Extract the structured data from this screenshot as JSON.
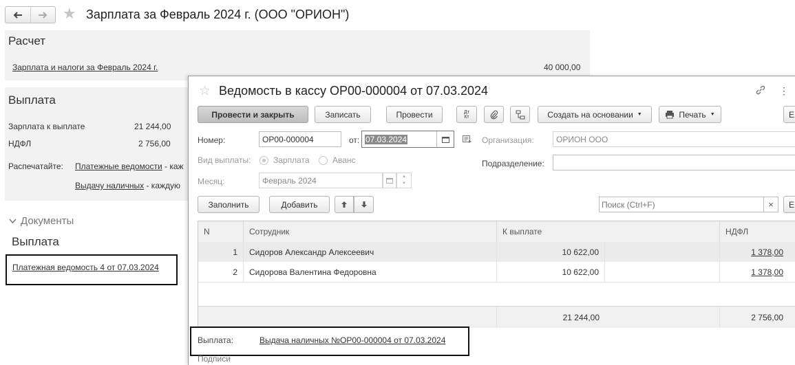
{
  "page": {
    "title": "Зарплата за Февраль 2024 г. (ООО \"ОРИОН\")"
  },
  "raschet": {
    "heading": "Расчет",
    "link_label": "Зарплата и налоги за Февраль 2024 г.",
    "amount": "40 000,00"
  },
  "vyplata": {
    "heading": "Выплата",
    "rows": [
      {
        "label": "Зарплата к выплате",
        "value": "21 244,00"
      },
      {
        "label": "НДФЛ",
        "value": "2 756,00"
      }
    ],
    "print_label": "Распечатайте:",
    "print_links": [
      {
        "label": "Платежные ведомости",
        "suffix": " - каж"
      },
      {
        "label": "Выдачу наличных",
        "suffix": " - каждую"
      }
    ]
  },
  "documents": {
    "toggle_label": "Документы",
    "heading": "Выплата",
    "doc_link": "Платежная ведомость 4 от 07.03.2024"
  },
  "dialog": {
    "title": "Ведомость в кассу ОР00-000004 от 07.03.2024",
    "toolbar": {
      "post_close": "Провести и закрыть",
      "save": "Записать",
      "post": "Провести",
      "dtkt": "Дт Кт",
      "create_based": "Создать на основании",
      "print": "Печать",
      "more": "Е"
    },
    "fields": {
      "number_label": "Номер:",
      "number_value": "ОР00-000004",
      "date_label": "от:",
      "date_value": "07.03.2024",
      "org_label": "Организация:",
      "org_value": "ОРИОН ООО",
      "paytype_label": "Вид выплаты:",
      "paytype_option1": "Зарплата",
      "paytype_option2": "Аванс",
      "division_label": "Подразделение:",
      "division_value": "",
      "month_label": "Месяц:",
      "month_value": "Февраль 2024"
    },
    "table_toolbar": {
      "fill": "Заполнить",
      "add": "Добавить",
      "search_placeholder": "Поиск (Ctrl+F)",
      "clear": "×",
      "more": "Е"
    },
    "table": {
      "headers": {
        "n": "N",
        "employee": "Сотрудник",
        "to_pay": "К выплате",
        "ndfl": "НДФЛ"
      },
      "rows": [
        {
          "n": "1",
          "employee": "Сидоров Александр Алексеевич",
          "to_pay": "10 622,00",
          "ndfl": "1 378,00"
        },
        {
          "n": "2",
          "employee": "Сидорова Валентина Федоровна",
          "to_pay": "10 622,00",
          "ndfl": "1 378,00"
        }
      ],
      "totals": {
        "to_pay": "21 244,00",
        "ndfl": "2 756,00"
      }
    },
    "footer": {
      "payment_label": "Выплата:",
      "payment_link": "Выдача наличных №ОР00-000004 от 07.03.2024",
      "signatures_label": "Подписи"
    }
  }
}
